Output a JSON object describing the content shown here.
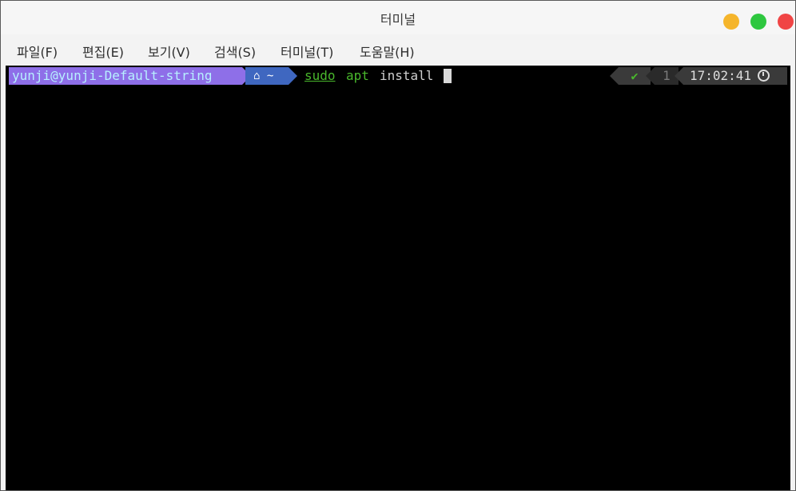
{
  "window": {
    "title": "터미널"
  },
  "menu": [
    {
      "label": "파일(F)"
    },
    {
      "label": "편집(E)"
    },
    {
      "label": "보기(V)"
    },
    {
      "label": "검색(S)"
    },
    {
      "label": "터미널(T)"
    },
    {
      "label": "도움말(H)"
    }
  ],
  "prompt": {
    "user_host": "yunji@yunji-Default-string",
    "dir": "~",
    "home_icon": "⌂",
    "command": {
      "sudo": "sudo",
      "apt": "apt",
      "arg": "install"
    },
    "status_icon": "✔",
    "jobs": "1",
    "time": "17:02:41"
  },
  "colors": {
    "user_segment": "#8e6fe8",
    "dir_segment": "#3f67c0",
    "command_green": "#49b82c",
    "terminal_bg": "#000000"
  }
}
